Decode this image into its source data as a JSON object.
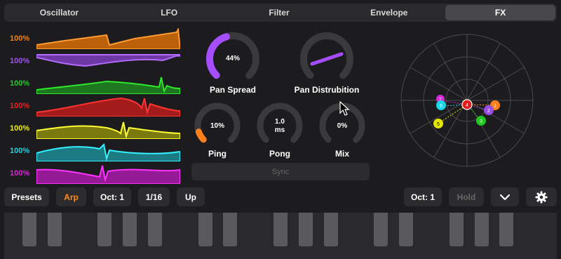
{
  "tabs": [
    {
      "label": "Oscillator",
      "active": false
    },
    {
      "label": "LFO",
      "active": false
    },
    {
      "label": "Filter",
      "active": false
    },
    {
      "label": "Envelope",
      "active": false
    },
    {
      "label": "FX",
      "active": true
    }
  ],
  "waves": [
    {
      "label": "100%",
      "color": "#ff7f00"
    },
    {
      "label": "100%",
      "color": "#a64dff"
    },
    {
      "label": "100%",
      "color": "#1ed11e"
    },
    {
      "label": "100%",
      "color": "#ff1a1a"
    },
    {
      "label": "100%",
      "color": "#f0f000"
    },
    {
      "label": "100%",
      "color": "#1ad7e6"
    },
    {
      "label": "100%",
      "color": "#e61ae6"
    }
  ],
  "knobs": {
    "pan_spread": {
      "label": "Pan Spread",
      "value": "44%",
      "level": 0.44
    },
    "pan_distribution": {
      "label": "Pan Distrubition"
    },
    "ping": {
      "label": "Ping",
      "value": "10%",
      "level": 0.1
    },
    "pong": {
      "label": "Pong",
      "value_line1": "1.0",
      "value_line2": "ms"
    },
    "mix": {
      "label": "Mix",
      "value": "0%",
      "level": 0.0
    }
  },
  "sync_label": "Sync",
  "polar": {
    "nodes": [
      {
        "label": "7",
        "color": "#d62ad6"
      },
      {
        "label": "6",
        "color": "#1ad7e6"
      },
      {
        "label": "5",
        "color": "#e6e600"
      },
      {
        "label": "4",
        "color": "#e61a1a"
      },
      {
        "label": "1",
        "color": "#ff7f1a"
      },
      {
        "label": "2",
        "color": "#9a4de6"
      },
      {
        "label": "3",
        "color": "#1ec81e"
      }
    ]
  },
  "controls": {
    "presets": "Presets",
    "arp": "Arp",
    "oct_left": "Oct: 1",
    "rate": "1/16",
    "direction": "Up",
    "oct_right": "Oct: 1",
    "hold": "Hold"
  },
  "colors": {
    "accent": "#a64dff",
    "arp": "#ff8c1a",
    "ping": "#ff7f1a"
  }
}
